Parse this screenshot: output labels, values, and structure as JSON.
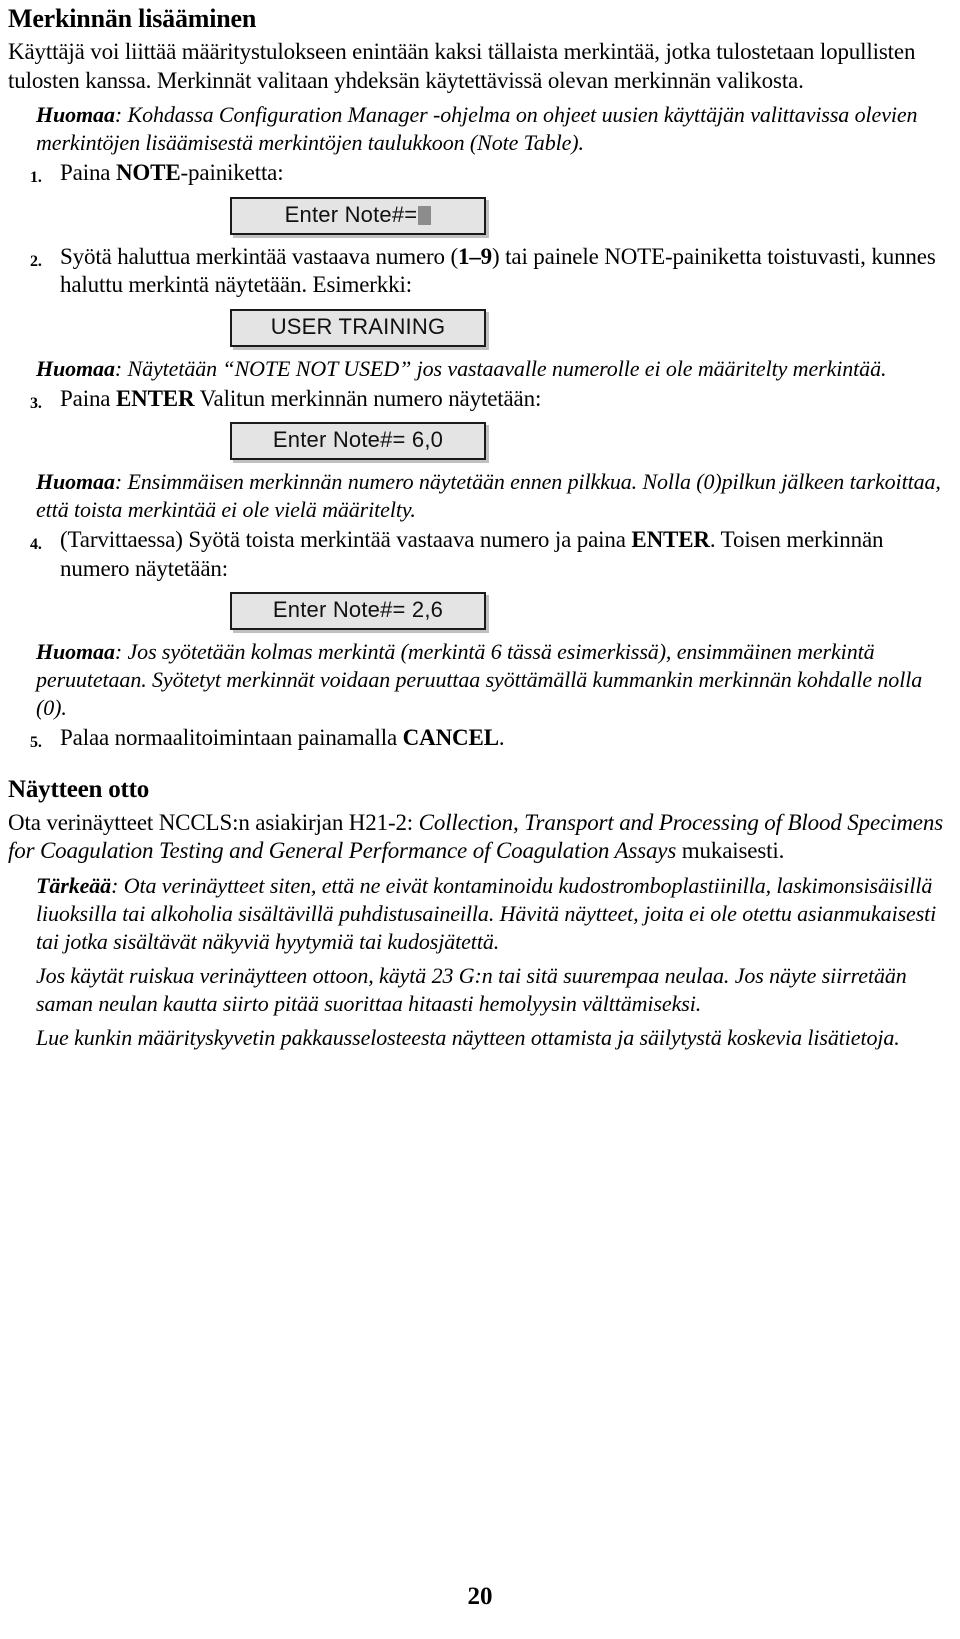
{
  "document": {
    "page_number": "20",
    "heading": "Merkinnän lisääminen",
    "intro": "Käyttäjä voi liittää määritystulokseen enintään kaksi tällaista merkintää, jotka tulostetaan lopullisten tulosten kanssa. Merkinnät valitaan yhdeksän käytettävissä olevan merkinnän valikosta.",
    "intro_note": {
      "label": "Huomaa",
      "text": ": Kohdassa Configuration Manager -ohjelma on ohjeet uusien käyttäjän valittavissa olevien merkintöjen lisäämisestä merkintöjen taulukkoon (Note Table)."
    },
    "steps": [
      {
        "number": "1.",
        "text_before": "Paina ",
        "bold": "NOTE",
        "text_after": "-painiketta:"
      },
      {
        "number": "2.",
        "text_before": "Syötä haluttua merkintää vastaava numero (",
        "bold": "1–9",
        "text_after": ") tai painele NOTE-painiketta toistuvasti, kunnes haluttu merkintä näytetään. Esimerkki:"
      },
      {
        "number": "3.",
        "text_before": "Paina ",
        "bold": "ENTER",
        "text_after": " Valitun merkinnän numero näytetään:"
      },
      {
        "number": "4.",
        "text_before": "(Tarvittaessa) Syötä toista merkintää vastaava numero ja paina ",
        "bold": "ENTER",
        "text_after": ". Toisen merkinnän numero näytetään:"
      },
      {
        "number": "5.",
        "text_before": "Palaa normaalitoimintaan painamalla ",
        "bold": "CANCEL",
        "text_after": "."
      }
    ],
    "displays": [
      {
        "id": "display-enter-note-empty",
        "text": "Enter Note#=",
        "has_cursor": true
      },
      {
        "id": "display-user-training",
        "text": "USER TRAINING",
        "has_cursor": false
      },
      {
        "id": "display-enter-note-60",
        "text": "Enter Note#= 6,0",
        "has_cursor": false
      },
      {
        "id": "display-enter-note-26",
        "text": "Enter Note#= 2,6",
        "has_cursor": false
      }
    ],
    "notes": [
      {
        "label": "Huomaa",
        "text": ": Näytetään “NOTE NOT USED” jos vastaavalle numerolle ei ole määritelty merkintää."
      },
      {
        "label": "Huomaa",
        "text": ": Ensimmäisen merkinnän numero näytetään ennen pilkkua. Nolla (0)pilkun jälkeen tarkoittaa, että toista merkintää ei ole vielä määritelty."
      },
      {
        "label": "Huomaa",
        "text": ": Jos syötetään kolmas merkintä (merkintä 6 tässä esimerkissä), ensimmäinen merkintä peruutetaan. Syötetyt merkinnät voidaan peruuttaa syöttämällä kummankin merkinnän kohdalle nolla (0)."
      }
    ],
    "sampling": {
      "heading": "Näytteen otto",
      "paragraph_plain_1": "Ota verinäytteet NCCLS:n asiakirjan H21-2: ",
      "paragraph_italic_1": "Collection, Transport and Processing of Blood Specimens for Coagulation Testing and General Performance of Coagulation Assays",
      "paragraph_plain_2": " mukaisesti.",
      "important_label": "Tärkeää",
      "important_text": ": Ota verinäytteet siten, että ne eivät kontaminoidu kudostromboplastiinilla, laskimonsisäisillä liuoksilla tai alkoholia sisältävillä puhdistusaineilla. Hävitä näytteet, joita ei ole otettu asianmukaisesti tai jotka sisältävät näkyviä hyytymiä tai kudosjätettä.",
      "paragraph_2": "Jos käytät ruiskua verinäytteen ottoon, käytä 23 G:n tai sitä suurempaa neulaa. Jos näyte siirretään saman neulan kautta siirto pitää suorittaa hitaasti hemolyysin välttämiseksi.",
      "paragraph_3": "Lue kunkin määrityskyvetin pakkausselosteesta näytteen ottamista ja säilytystä koskevia lisätietoja."
    },
    "colors": {
      "display_fill": "#e4e4e4",
      "display_border": "#1a1a1a",
      "cursor": "#8c8c8c",
      "text": "#000000"
    }
  }
}
